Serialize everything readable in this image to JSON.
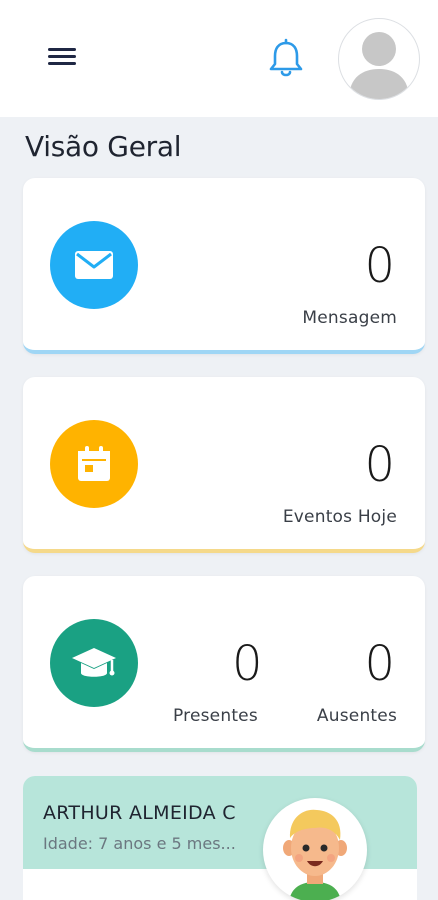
{
  "header": {
    "menu_icon": "hamburger-menu-icon",
    "bell_icon": "bell-icon",
    "avatar_icon": "user-avatar-icon"
  },
  "page": {
    "title": "Visão Geral"
  },
  "stats": [
    {
      "icon": "mail-icon",
      "value": "0",
      "label": "Mensagem",
      "color": "#21aef5",
      "accent": "#9fd6f5"
    },
    {
      "icon": "calendar-icon",
      "value": "0",
      "label": "Eventos Hoje",
      "color": "#ffb300",
      "accent": "#f5d98a"
    },
    {
      "icon": "graduation-cap-icon",
      "present_value": "0",
      "present_label": "Presentes",
      "absent_value": "0",
      "absent_label": "Ausentes",
      "color": "#1aa183",
      "accent": "#a8dccd"
    }
  ],
  "student": {
    "name": "ARTHUR ALMEIDA C",
    "age": "Idade: 7 anos e 5 mes...",
    "header_color": "#b7e5da"
  }
}
